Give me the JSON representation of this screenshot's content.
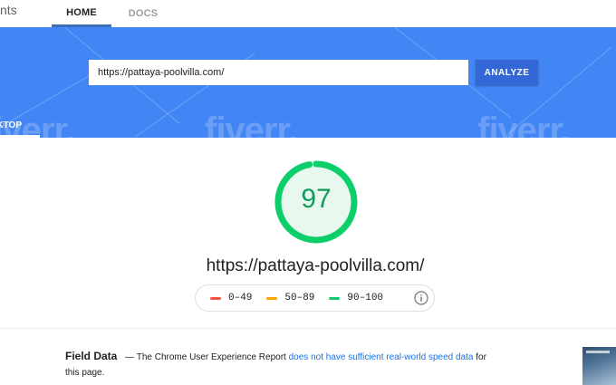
{
  "nav": {
    "brand_fragment": "nts",
    "tabs": [
      {
        "label": "HOME",
        "active": true
      },
      {
        "label": "DOCS",
        "active": false
      }
    ]
  },
  "search": {
    "url_value": "https://pattaya-poolvilla.com/",
    "button_label": "ANALYZE"
  },
  "device_tab": {
    "label": "KTOP"
  },
  "watermark": {
    "text": "fiverr."
  },
  "score": {
    "value": "97",
    "fraction": 0.97,
    "color": "#0cce6b"
  },
  "page_url": "https://pattaya-poolvilla.com/",
  "legend": [
    {
      "range": "0–49",
      "color": "#ff4e42"
    },
    {
      "range": "50–89",
      "color": "#ffa400"
    },
    {
      "range": "90–100",
      "color": "#0cce6b"
    }
  ],
  "field_data": {
    "title": "Field Data",
    "dash": "—",
    "text_before": "The Chrome User Experience Report",
    "link_text": "does not have sufficient real-world speed data",
    "text_after": "for",
    "line2": "this page."
  },
  "colors": {
    "hero_blue": "#4285f4",
    "button_blue": "#3367d6",
    "link_blue": "#1a73e8"
  }
}
